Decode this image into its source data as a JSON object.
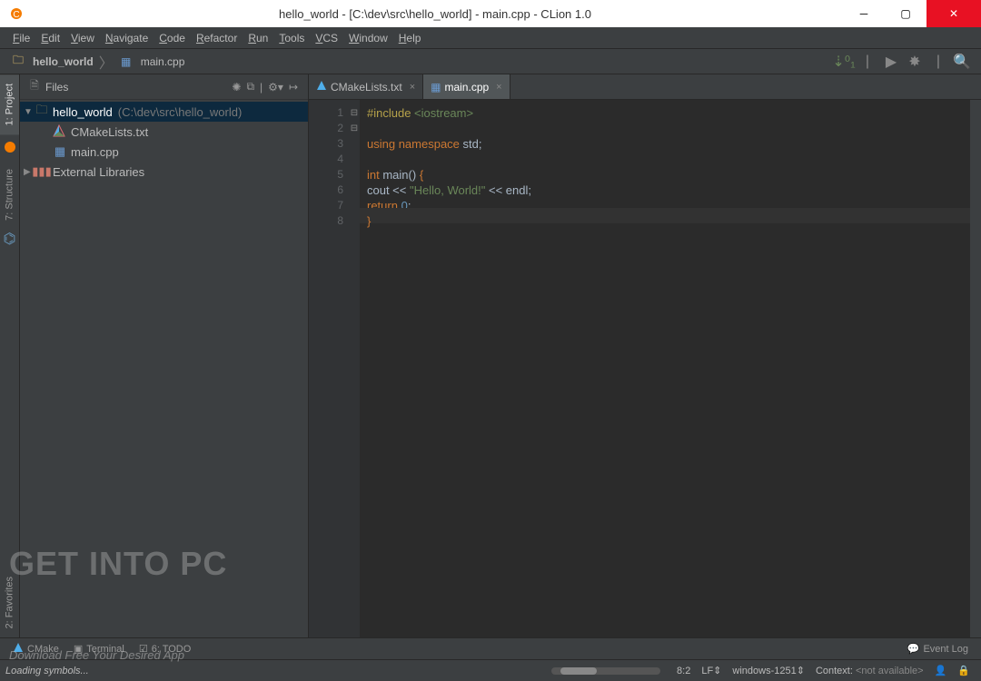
{
  "window": {
    "title": "hello_world - [C:\\dev\\src\\hello_world] - main.cpp - CLion 1.0"
  },
  "menu": {
    "items": [
      "File",
      "Edit",
      "View",
      "Navigate",
      "Code",
      "Refactor",
      "Run",
      "Tools",
      "VCS",
      "Window",
      "Help"
    ]
  },
  "breadcrumbs": {
    "project": "hello_world",
    "file": "main.cpp"
  },
  "gutter_tabs": {
    "project": "1: Project",
    "structure": "7: Structure",
    "favorites": "2: Favorites"
  },
  "project_panel": {
    "header": "Files",
    "tree": {
      "root_label": "hello_world",
      "root_path": "(C:\\dev\\src\\hello_world)",
      "children": [
        {
          "label": "CMakeLists.txt",
          "icon": "cmake"
        },
        {
          "label": "main.cpp",
          "icon": "cpp"
        }
      ],
      "external": "External Libraries"
    }
  },
  "editor": {
    "tabs": [
      {
        "label": "CMakeLists.txt",
        "icon": "cmake",
        "active": false
      },
      {
        "label": "main.cpp",
        "icon": "cpp",
        "active": true
      }
    ],
    "code_lines": [
      {
        "n": 1,
        "tokens": [
          {
            "t": "#include ",
            "c": "kw-include"
          },
          {
            "t": "<iostream>",
            "c": "str"
          }
        ]
      },
      {
        "n": 2,
        "tokens": []
      },
      {
        "n": 3,
        "tokens": [
          {
            "t": "using namespace ",
            "c": "kw-orange"
          },
          {
            "t": "std",
            "c": "ident"
          },
          {
            "t": ";",
            "c": "punct"
          }
        ]
      },
      {
        "n": 4,
        "tokens": []
      },
      {
        "n": 5,
        "tokens": [
          {
            "t": "int ",
            "c": "kw-orange"
          },
          {
            "t": "main",
            "c": "ident"
          },
          {
            "t": "() ",
            "c": "punct"
          },
          {
            "t": "{",
            "c": "brace"
          }
        ],
        "fold": "-"
      },
      {
        "n": 6,
        "tokens": [
          {
            "t": "    cout << ",
            "c": "ident"
          },
          {
            "t": "\"Hello, World!\"",
            "c": "str"
          },
          {
            "t": " << endl;",
            "c": "ident"
          }
        ]
      },
      {
        "n": 7,
        "tokens": [
          {
            "t": "    ",
            "c": ""
          },
          {
            "t": "return ",
            "c": "kw-orange"
          },
          {
            "t": "0",
            "c": "num"
          },
          {
            "t": ";",
            "c": "punct"
          }
        ]
      },
      {
        "n": 8,
        "tokens": [
          {
            "t": "}",
            "c": "brace"
          }
        ],
        "hl": true,
        "fold": "-"
      }
    ]
  },
  "bottom_tabs": {
    "cmake": "CMake",
    "terminal": "Terminal",
    "todo": "6: TODO",
    "eventlog": "Event Log"
  },
  "status": {
    "loading": "Loading symbols...",
    "pos": "8:2",
    "lineend": "LF",
    "encoding": "windows-1251",
    "context_label": "Context:",
    "context_val": "<not available>"
  },
  "watermark": {
    "big": "GET INTO PC",
    "small": "Download Free Your Desired App"
  }
}
